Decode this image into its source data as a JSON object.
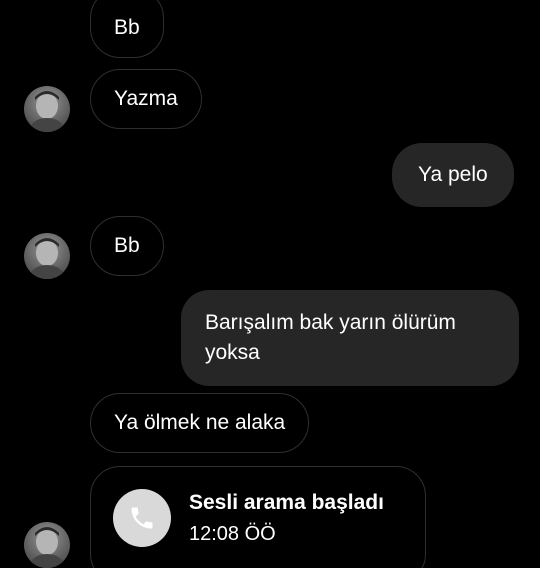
{
  "conversation": {
    "messages": [
      {
        "from": "contact",
        "text": "Bb"
      },
      {
        "from": "contact",
        "text": "Yazma"
      },
      {
        "from": "me",
        "text": "Ya pelo"
      },
      {
        "from": "contact",
        "text": "Bb"
      },
      {
        "from": "me",
        "text": "Barışalım bak yarın ölürüm yoksa"
      },
      {
        "from": "contact",
        "text": "Ya ölmek ne alaka"
      }
    ],
    "call": {
      "title": "Sesli arama başladı",
      "time": "12:08 ÖÖ",
      "icon": "phone-icon"
    }
  },
  "colors": {
    "background": "#000000",
    "outgoing_bubble": "#262626",
    "incoming_border": "#2f2f2f",
    "call_icon_bg": "#d9d9d9"
  }
}
